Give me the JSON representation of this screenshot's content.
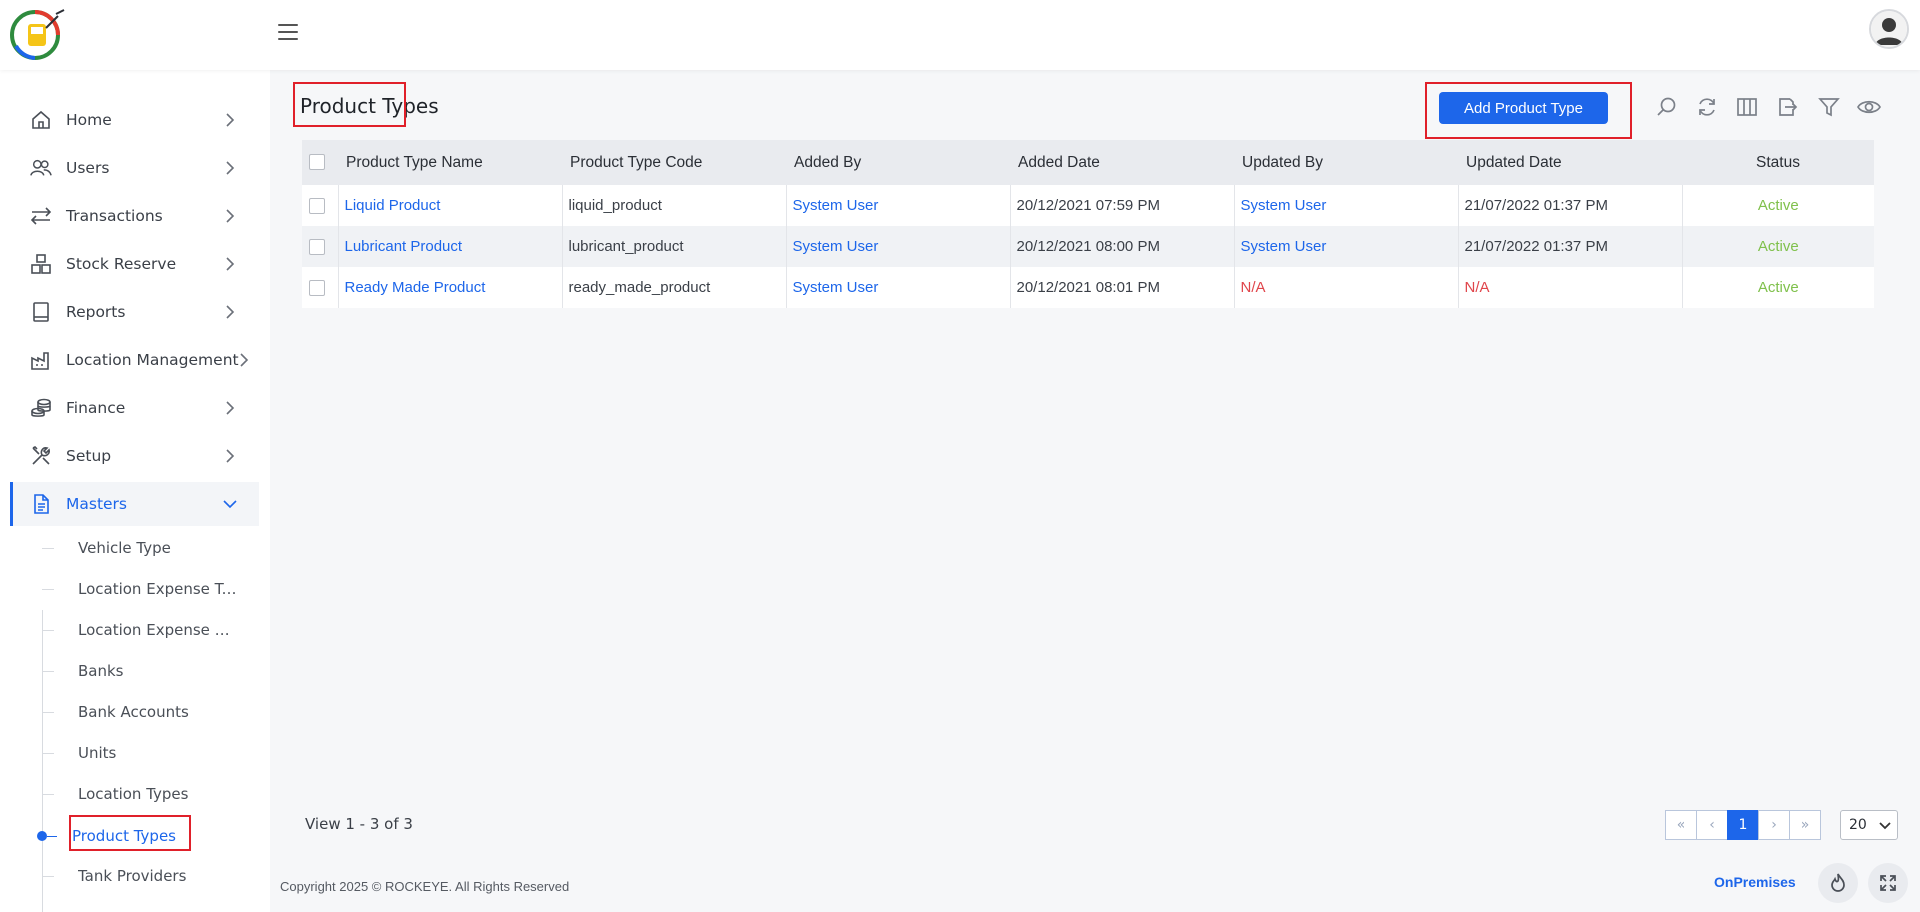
{
  "header": {
    "logo_icon": "fuel-logo-icon",
    "menu_icon": "hamburger-menu-icon",
    "avatar_icon": "user-avatar-icon"
  },
  "sidebar": {
    "items": [
      {
        "label": "Home",
        "icon": "home-icon"
      },
      {
        "label": "Users",
        "icon": "users-icon"
      },
      {
        "label": "Transactions",
        "icon": "transfer-arrows-icon"
      },
      {
        "label": "Stock Reserve",
        "icon": "stock-boxes-icon"
      },
      {
        "label": "Reports",
        "icon": "report-icon"
      },
      {
        "label": "Location Management",
        "icon": "factory-icon"
      },
      {
        "label": "Finance",
        "icon": "coins-icon"
      },
      {
        "label": "Setup",
        "icon": "tools-icon"
      },
      {
        "label": "Masters",
        "icon": "document-icon",
        "active": true
      }
    ],
    "sub_items": [
      {
        "label": "Vehicle Type"
      },
      {
        "label": "Location Expense Types"
      },
      {
        "label": "Location Expense Master"
      },
      {
        "label": "Banks"
      },
      {
        "label": "Bank Accounts"
      },
      {
        "label": "Units"
      },
      {
        "label": "Location Types"
      },
      {
        "label": "Product Types",
        "active": true
      },
      {
        "label": "Tank Providers"
      }
    ]
  },
  "main": {
    "title": "Product Types",
    "add_button": "Add Product Type",
    "toolbar_icons": [
      "search-icon",
      "refresh-icon",
      "columns-icon",
      "export-icon",
      "filter-icon",
      "eye-icon"
    ],
    "table": {
      "columns": [
        "Product Type Name",
        "Product Type Code",
        "Added By",
        "Added Date",
        "Updated By",
        "Updated Date",
        "Status"
      ],
      "rows": [
        {
          "name": "Liquid Product",
          "code": "liquid_product",
          "added_by": "System User",
          "added_date": "20/12/2021 07:59 PM",
          "updated_by": "System User",
          "updated_date": "21/07/2022 01:37 PM",
          "status": "Active"
        },
        {
          "name": "Lubricant Product",
          "code": "lubricant_product",
          "added_by": "System User",
          "added_date": "20/12/2021 08:00 PM",
          "updated_by": "System User",
          "updated_date": "21/07/2022 01:37 PM",
          "status": "Active"
        },
        {
          "name": "Ready Made Product",
          "code": "ready_made_product",
          "added_by": "System User",
          "added_date": "20/12/2021 08:01 PM",
          "updated_by": "N/A",
          "updated_date": "N/A",
          "status": "Active"
        }
      ]
    },
    "view_count": "View 1 - 3 of 3",
    "pagination": {
      "first": "«",
      "prev": "‹",
      "current": "1",
      "next": "›",
      "last": "»"
    },
    "page_size": "20"
  },
  "footer": {
    "copyright": "Copyright 2025 © ROCKEYE. All Rights Reserved",
    "mode": "OnPremises",
    "buttons": [
      "flame-icon",
      "fullscreen-icon"
    ]
  },
  "colors": {
    "accent": "#1d66ea",
    "na": "#e0454b",
    "active_status": "#7fc04b",
    "highlight": "#e0202a"
  }
}
